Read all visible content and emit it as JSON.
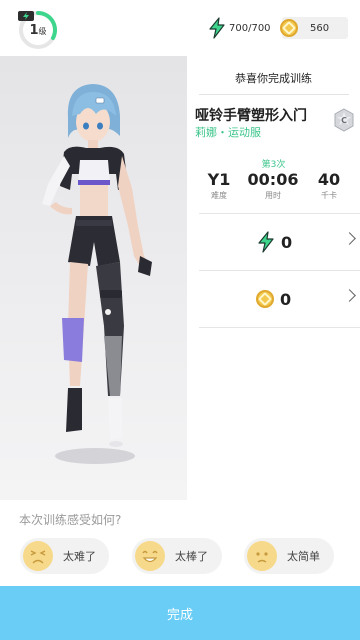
{
  "header": {
    "level_value": "1",
    "level_unit": "级",
    "energy": "700/700",
    "coins": "560"
  },
  "results": {
    "title": "恭喜你完成训练",
    "course_name": "哑铃手臂塑形入门",
    "course_subtitle": "莉娜・运动服",
    "attempt": "第3次",
    "stats": [
      {
        "value": "Y1",
        "label": "难度"
      },
      {
        "value": "00:06",
        "label": "用时"
      },
      {
        "value": "40",
        "label": "千卡"
      }
    ],
    "energy_reward": "0",
    "coin_reward": "0"
  },
  "feedback": {
    "question": "本次训练感受如何?",
    "options": [
      {
        "label": "太难了",
        "icon": "sad-face-icon"
      },
      {
        "label": "太棒了",
        "icon": "happy-face-icon"
      },
      {
        "label": "太简单",
        "icon": "neutral-face-icon"
      }
    ]
  },
  "footer": {
    "finish_label": "完成"
  },
  "colors": {
    "accent_green": "#3dc58b",
    "finish_blue": "#69cdf6",
    "coin_gold": "#f2c94c"
  }
}
